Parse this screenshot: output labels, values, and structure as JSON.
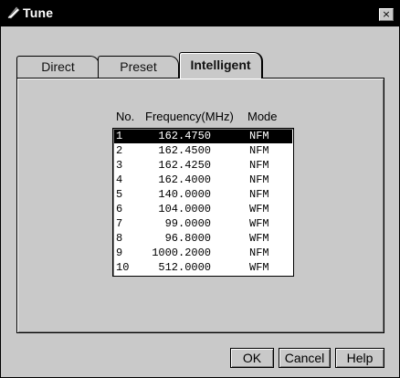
{
  "window": {
    "title": "Tune",
    "close_label": "×"
  },
  "tabs": [
    {
      "label": "Direct",
      "active": false
    },
    {
      "label": "Preset",
      "active": false
    },
    {
      "label": "Intelligent",
      "active": true
    }
  ],
  "list": {
    "headers": {
      "no": "No.",
      "frequency": "Frequency(MHz)",
      "mode": "Mode"
    },
    "selected_index": 0,
    "rows": [
      {
        "no": "1",
        "frequency": "162.4750",
        "mode": "NFM"
      },
      {
        "no": "2",
        "frequency": "162.4500",
        "mode": "NFM"
      },
      {
        "no": "3",
        "frequency": "162.4250",
        "mode": "NFM"
      },
      {
        "no": "4",
        "frequency": "162.4000",
        "mode": "NFM"
      },
      {
        "no": "5",
        "frequency": "140.0000",
        "mode": "NFM"
      },
      {
        "no": "6",
        "frequency": "104.0000",
        "mode": "WFM"
      },
      {
        "no": "7",
        "frequency": "99.0000",
        "mode": "WFM"
      },
      {
        "no": "8",
        "frequency": "96.8000",
        "mode": "WFM"
      },
      {
        "no": "9",
        "frequency": "1000.2000",
        "mode": "NFM"
      },
      {
        "no": "10",
        "frequency": "512.0000",
        "mode": "WFM"
      }
    ]
  },
  "buttons": {
    "ok": "OK",
    "cancel": "Cancel",
    "help": "Help"
  }
}
